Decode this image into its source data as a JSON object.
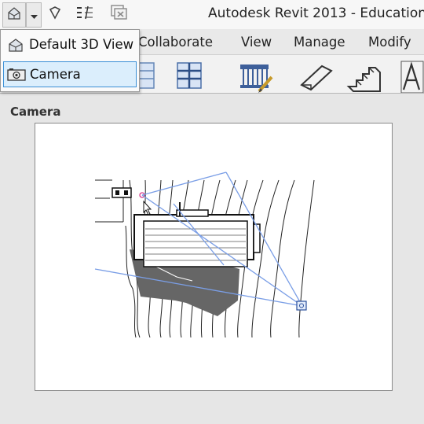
{
  "window": {
    "title": "Autodesk Revit 2013 - Educational"
  },
  "quick_access": {
    "icons": [
      "home-3d-icon",
      "dropdown-arrow-icon",
      "measure-icon",
      "thin-lines-icon",
      "close-hidden-icon"
    ]
  },
  "ribbon": {
    "tabs": [
      {
        "label": "Collaborate"
      },
      {
        "label": "View"
      },
      {
        "label": "Manage"
      },
      {
        "label": "Modify"
      }
    ]
  },
  "view_dropdown": {
    "items": [
      {
        "label": "Default 3D View",
        "icon": "house-3d-icon",
        "selected": false
      },
      {
        "label": "Camera",
        "icon": "camera-icon",
        "selected": true
      }
    ]
  },
  "preview_panel": {
    "title": "Camera"
  },
  "colors": {
    "camera_line": "#7a9ee6",
    "selection_border": "#3a8fd6",
    "selection_fill": "#dbeefc"
  }
}
